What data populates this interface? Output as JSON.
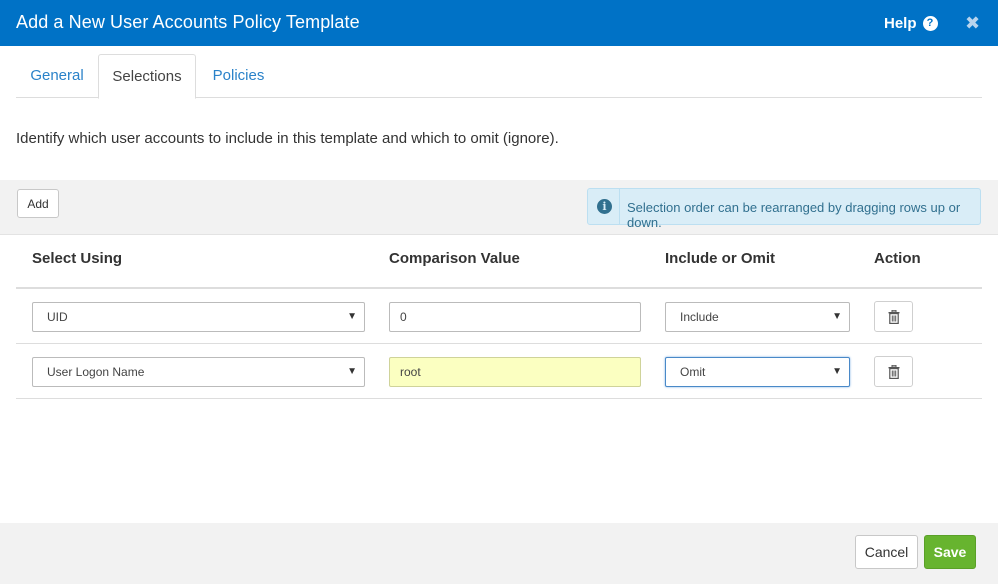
{
  "dialog": {
    "title": "Add a New User Accounts Policy Template",
    "help_label": "Help",
    "help_icon": "?",
    "close_icon": "✖"
  },
  "tabs": [
    {
      "label": "General",
      "active": false
    },
    {
      "label": "Selections",
      "active": true
    },
    {
      "label": "Policies",
      "active": false
    }
  ],
  "intro_text": "Identify which user accounts to include in this template and which to omit (ignore).",
  "toolbar": {
    "add_label": "Add",
    "info_message": "Selection order can be rearranged by dragging rows up or down.",
    "info_icon": "i"
  },
  "table": {
    "headers": {
      "select_using": "Select Using",
      "comparison_value": "Comparison Value",
      "include_or_omit": "Include or Omit",
      "action": "Action"
    },
    "rows": [
      {
        "select_using": "UID",
        "comparison_value": "0",
        "include_or_omit": "Include"
      },
      {
        "select_using": "User Logon Name",
        "comparison_value": "root",
        "include_or_omit": "Omit"
      }
    ]
  },
  "footer": {
    "cancel_label": "Cancel",
    "save_label": "Save"
  },
  "colors": {
    "titlebar": "#0072c6",
    "tab_link": "#2a82c9",
    "info_bg": "#d9edf7",
    "highlight_input": "#fbffc1",
    "save_button": "#67b42f"
  }
}
